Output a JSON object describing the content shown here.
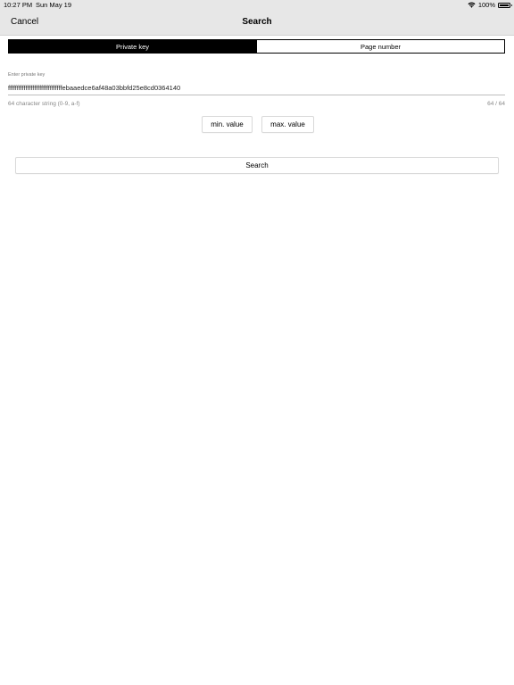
{
  "status_bar": {
    "time": "10:27 PM",
    "date": "Sun May 19",
    "battery": "100%",
    "battery_level": 1.0
  },
  "nav": {
    "cancel_label": "Cancel",
    "title": "Search"
  },
  "segmented": {
    "items": [
      {
        "label": "Private key",
        "selected": true
      },
      {
        "label": "Page number",
        "selected": false
      }
    ]
  },
  "private_key_field": {
    "label": "Enter private key",
    "value": "fffffffffffffffffffffffffffffffebaaedce6af48a03bbfd25e8cd0364140",
    "helper": "64 character string (0-9, a-f)",
    "counter": "64 / 64"
  },
  "buttons": {
    "min_label": "min. value",
    "max_label": "max. value",
    "search_label": "Search"
  },
  "icons": {
    "wifi": "wifi-icon",
    "battery": "battery-icon"
  }
}
